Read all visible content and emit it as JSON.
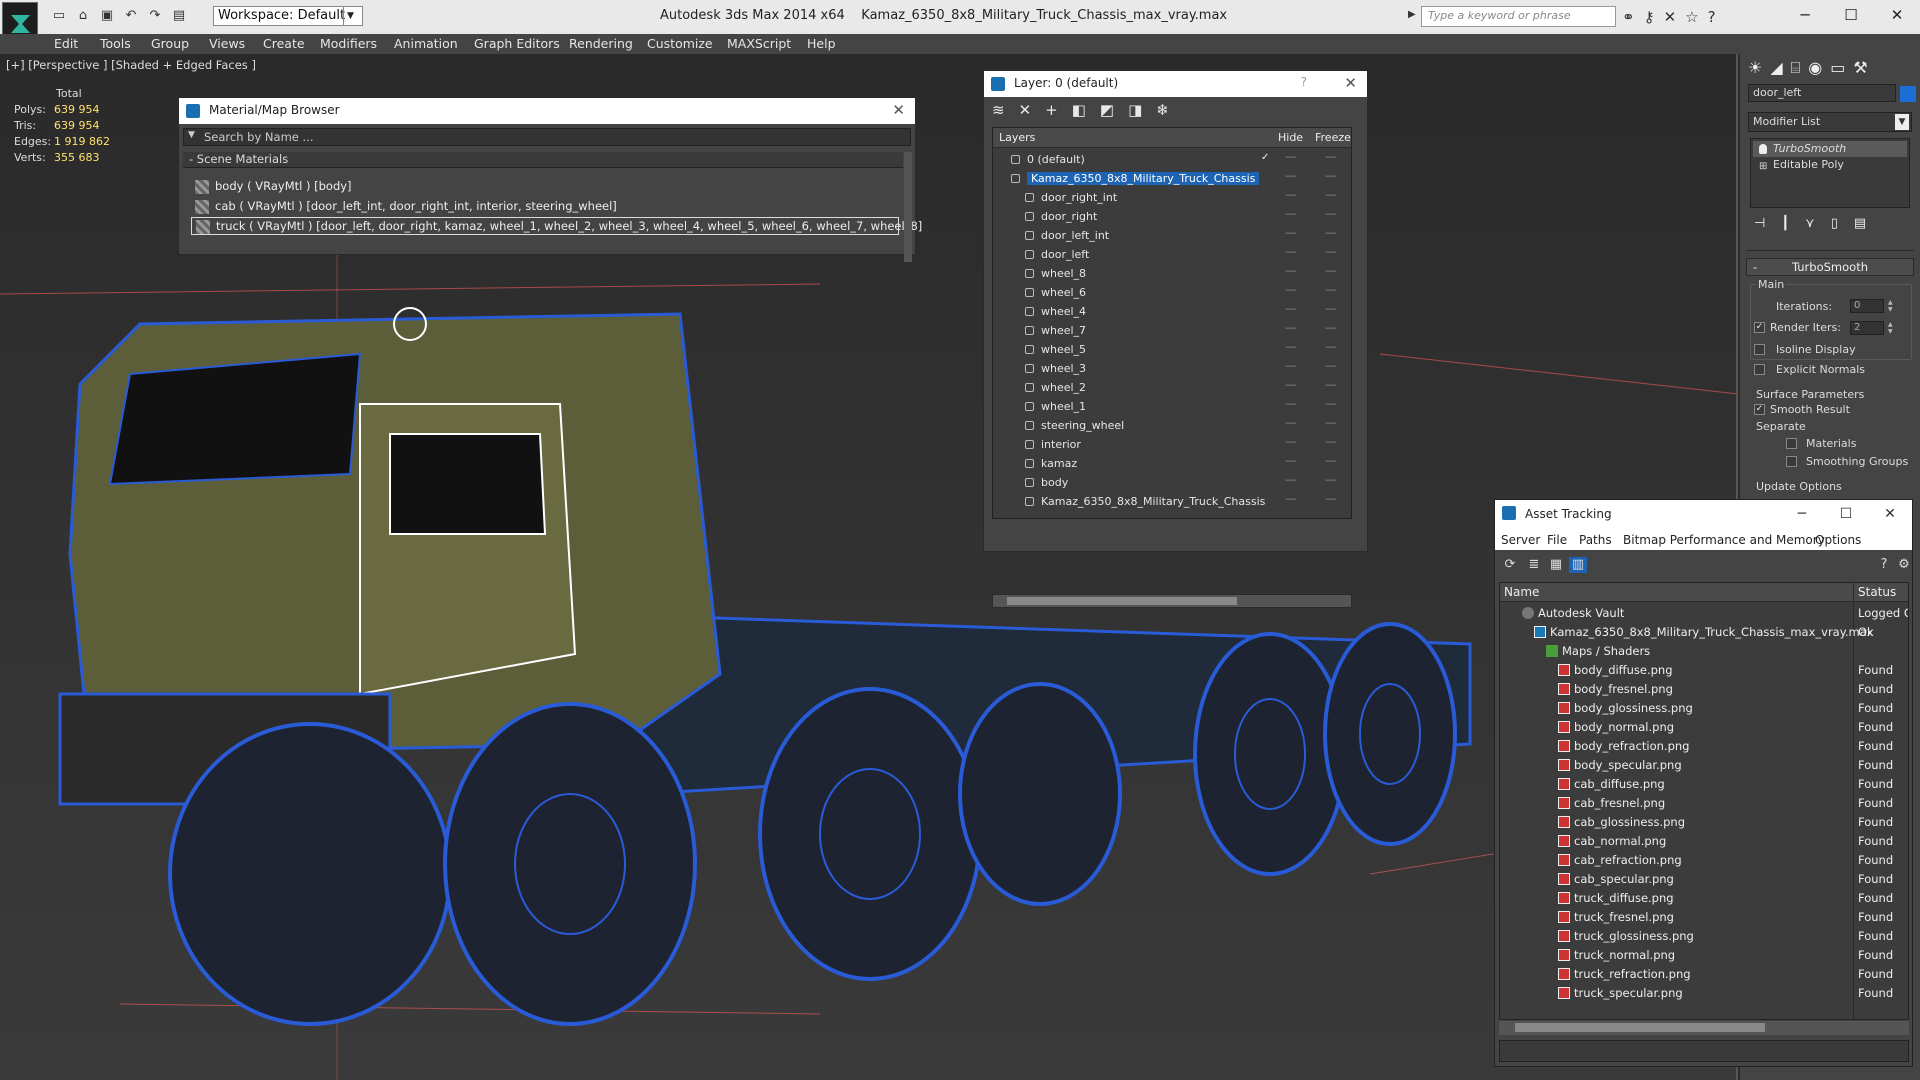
{
  "app": {
    "title": "Autodesk 3ds Max  2014 x64",
    "file": "Kamaz_6350_8x8_Military_Truck_Chassis_max_vray.max",
    "workspace": "Workspace: Default",
    "search_placeholder": "Type a keyword or phrase"
  },
  "menu": [
    "Edit",
    "Tools",
    "Group",
    "Views",
    "Create",
    "Modifiers",
    "Animation",
    "Graph Editors",
    "Rendering",
    "Customize",
    "MAXScript",
    "Help"
  ],
  "viewport": {
    "label": "[+] [Perspective ] [Shaded + Edged Faces ]",
    "stats_header": "Total",
    "stats": [
      {
        "k": "Polys:",
        "v": "639 954"
      },
      {
        "k": "Tris:",
        "v": "639 954"
      },
      {
        "k": "Edges:",
        "v": "1 919 862"
      },
      {
        "k": "Verts:",
        "v": "355 683"
      }
    ]
  },
  "material_browser": {
    "title": "Material/Map Browser",
    "search_placeholder": "Search by Name ...",
    "group": "- Scene Materials",
    "rows": [
      "body  ( VRayMtl ) [body]",
      "cab  ( VRayMtl ) [door_left_int, door_right_int, interior, steering_wheel]",
      "truck  ( VRayMtl ) [door_left, door_right, kamaz, wheel_1, wheel_2, wheel_3, wheel_4, wheel_5, wheel_6, wheel_7, wheel_8]"
    ]
  },
  "layer": {
    "title": "Layer: 0 (default)",
    "help": "?",
    "cols": {
      "layers": "Layers",
      "hide": "Hide",
      "freeze": "Freeze"
    },
    "rows": [
      {
        "name": "0 (default)",
        "level": 1,
        "kind": "layer",
        "check": "✓"
      },
      {
        "name": "Kamaz_6350_8x8_Military_Truck_Chassis",
        "level": 1,
        "kind": "layer",
        "selected": true
      },
      {
        "name": "door_right_int",
        "level": 2,
        "kind": "obj"
      },
      {
        "name": "door_right",
        "level": 2,
        "kind": "obj"
      },
      {
        "name": "door_left_int",
        "level": 2,
        "kind": "obj"
      },
      {
        "name": "door_left",
        "level": 2,
        "kind": "obj"
      },
      {
        "name": "wheel_8",
        "level": 2,
        "kind": "obj"
      },
      {
        "name": "wheel_6",
        "level": 2,
        "kind": "obj"
      },
      {
        "name": "wheel_4",
        "level": 2,
        "kind": "obj"
      },
      {
        "name": "wheel_7",
        "level": 2,
        "kind": "obj"
      },
      {
        "name": "wheel_5",
        "level": 2,
        "kind": "obj"
      },
      {
        "name": "wheel_3",
        "level": 2,
        "kind": "obj"
      },
      {
        "name": "wheel_2",
        "level": 2,
        "kind": "obj"
      },
      {
        "name": "wheel_1",
        "level": 2,
        "kind": "obj"
      },
      {
        "name": "steering_wheel",
        "level": 2,
        "kind": "obj"
      },
      {
        "name": "interior",
        "level": 2,
        "kind": "obj"
      },
      {
        "name": "kamaz",
        "level": 2,
        "kind": "obj"
      },
      {
        "name": "body",
        "level": 2,
        "kind": "obj"
      },
      {
        "name": "Kamaz_6350_8x8_Military_Truck_Chassis",
        "level": 2,
        "kind": "obj"
      }
    ]
  },
  "command_panel": {
    "object_name": "door_left",
    "object_color": "#1a6fd4",
    "modifier_list": "Modifier List",
    "stack": [
      "TurboSmooth",
      "Editable Poly"
    ],
    "rollout_title": "TurboSmooth",
    "main_group": "Main",
    "iterations_label": "Iterations:",
    "iterations_value": "0",
    "render_iters_label": "Render Iters:",
    "render_iters_value": "2",
    "render_iters_checked": true,
    "isoline": "Isoline Display",
    "explicit_normals": "Explicit Normals",
    "surface_params": "Surface Parameters",
    "smooth_result": "Smooth Result",
    "separate": "Separate",
    "materials": "Materials",
    "smoothing_groups": "Smoothing Groups",
    "update_options": "Update Options"
  },
  "asset_tracking": {
    "title": "Asset Tracking",
    "menu": [
      "Server",
      "File",
      "Paths",
      "Bitmap Performance and Memory",
      "Options"
    ],
    "cols": {
      "name": "Name",
      "status": "Status"
    },
    "rows": [
      {
        "name": "Autodesk Vault",
        "status": "Logged O",
        "level": 1,
        "icon": "vault"
      },
      {
        "name": "Kamaz_6350_8x8_Military_Truck_Chassis_max_vray.max",
        "status": "Ok",
        "level": 2,
        "icon": "max"
      },
      {
        "name": "Maps / Shaders",
        "status": "",
        "level": 3,
        "icon": "fold"
      },
      {
        "name": "body_diffuse.png",
        "status": "Found",
        "level": 4,
        "icon": "png"
      },
      {
        "name": "body_fresnel.png",
        "status": "Found",
        "level": 4,
        "icon": "png"
      },
      {
        "name": "body_glossiness.png",
        "status": "Found",
        "level": 4,
        "icon": "png"
      },
      {
        "name": "body_normal.png",
        "status": "Found",
        "level": 4,
        "icon": "png"
      },
      {
        "name": "body_refraction.png",
        "status": "Found",
        "level": 4,
        "icon": "png"
      },
      {
        "name": "body_specular.png",
        "status": "Found",
        "level": 4,
        "icon": "png"
      },
      {
        "name": "cab_diffuse.png",
        "status": "Found",
        "level": 4,
        "icon": "png"
      },
      {
        "name": "cab_fresnel.png",
        "status": "Found",
        "level": 4,
        "icon": "png"
      },
      {
        "name": "cab_glossiness.png",
        "status": "Found",
        "level": 4,
        "icon": "png"
      },
      {
        "name": "cab_normal.png",
        "status": "Found",
        "level": 4,
        "icon": "png"
      },
      {
        "name": "cab_refraction.png",
        "status": "Found",
        "level": 4,
        "icon": "png"
      },
      {
        "name": "cab_specular.png",
        "status": "Found",
        "level": 4,
        "icon": "png"
      },
      {
        "name": "truck_diffuse.png",
        "status": "Found",
        "level": 4,
        "icon": "png"
      },
      {
        "name": "truck_fresnel.png",
        "status": "Found",
        "level": 4,
        "icon": "png"
      },
      {
        "name": "truck_glossiness.png",
        "status": "Found",
        "level": 4,
        "icon": "png"
      },
      {
        "name": "truck_normal.png",
        "status": "Found",
        "level": 4,
        "icon": "png"
      },
      {
        "name": "truck_refraction.png",
        "status": "Found",
        "level": 4,
        "icon": "png"
      },
      {
        "name": "truck_specular.png",
        "status": "Found",
        "level": 4,
        "icon": "png"
      }
    ]
  }
}
